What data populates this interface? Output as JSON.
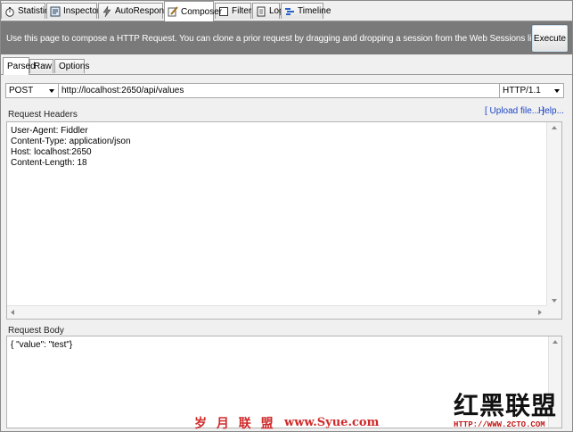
{
  "tabs": [
    {
      "label": "Statistics",
      "icon": "stopwatch-icon"
    },
    {
      "label": "Inspectors",
      "icon": "inspect-icon"
    },
    {
      "label": "AutoResponder",
      "icon": "lightning-icon"
    },
    {
      "label": "Composer",
      "icon": "pencil-icon",
      "active": true
    },
    {
      "label": "Filters",
      "icon": "checkbox-icon"
    },
    {
      "label": "Log",
      "icon": "document-icon"
    },
    {
      "label": "Timeline",
      "icon": "timeline-icon"
    }
  ],
  "infobar": {
    "text": "Use this page to compose a HTTP Request. You can clone a prior request by dragging and dropping a session from the Web Sessions list.",
    "execute_label": "Execute"
  },
  "subtabs": [
    {
      "label": "Parsed",
      "active": true
    },
    {
      "label": "Raw"
    },
    {
      "label": "Options"
    }
  ],
  "request": {
    "method": "POST",
    "url": "http://localhost:2650/api/values",
    "version": "HTTP/1.1"
  },
  "headers_section": {
    "label": "Request Headers",
    "upload_link": "[ Upload file... ]",
    "help_link": "Help...",
    "lines": [
      "User-Agent: Fiddler",
      "Content-Type: application/json",
      "Host: localhost:2650",
      "Content-Length: 18"
    ]
  },
  "body_section": {
    "label": "Request Body",
    "content": "{ \"value\": \"test\"}"
  },
  "watermarks": {
    "cn_text": "岁 月 联 盟",
    "site": "www.Syue.com",
    "logo": "红黑联盟",
    "logo_url": "HTTP://WWW.2CTO.COM"
  },
  "colors": {
    "infobar_bg": "#7a7a7a",
    "link": "#1a44c6",
    "watermark": "#d02a2a"
  }
}
